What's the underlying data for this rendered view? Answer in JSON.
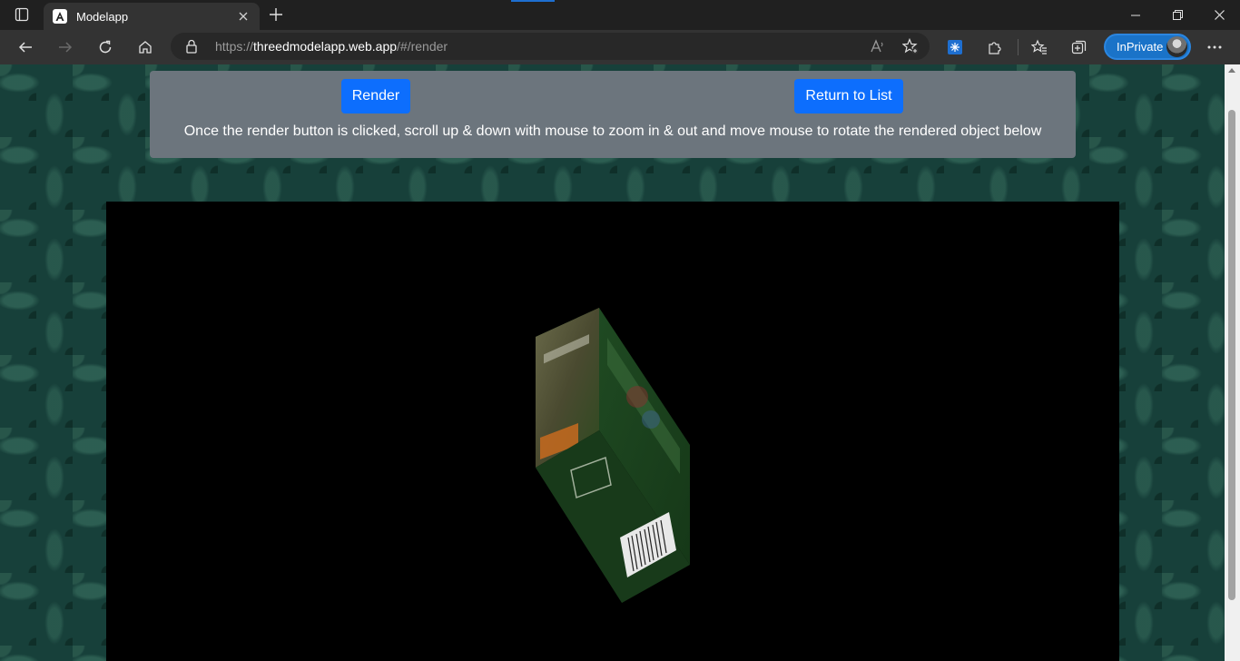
{
  "browser": {
    "tab_title": "Modelapp",
    "url_scheme": "https://",
    "url_host": "threedmodelapp.web.app",
    "url_path": "/#/render",
    "inprivate_label": "InPrivate"
  },
  "page": {
    "render_label": "Render",
    "return_label": "Return to List",
    "instructions": "Once the render button is clicked, scroll up & down with mouse to zoom in & out and move mouse to rotate the rendered object below"
  },
  "colors": {
    "primary": "#0d6efd",
    "panel": "#6c757d",
    "background_pattern": "#17403a",
    "canvas": "#000000"
  }
}
